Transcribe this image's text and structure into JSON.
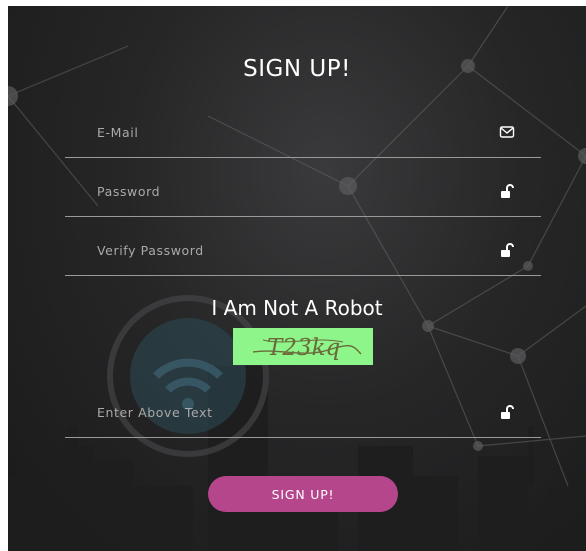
{
  "form": {
    "title": "SIGN UP!",
    "fields": [
      {
        "placeholder": "E-Mail",
        "value": "",
        "icon": "envelope-icon"
      },
      {
        "placeholder": "Password",
        "value": "",
        "icon": "unlock-icon"
      },
      {
        "placeholder": "Verify Password",
        "value": "",
        "icon": "unlock-icon"
      }
    ],
    "captcha": {
      "heading": "I Am Not A Robot",
      "text": "T23kq",
      "background": "#8ef58a",
      "input_placeholder": "Enter Above Text",
      "input_value": "",
      "icon": "unlock-icon"
    },
    "submit_label": "SIGN UP!"
  },
  "colors": {
    "background": "#262627",
    "button": "#b5468c",
    "text": "#ffffff",
    "placeholder": "#a9a9a9",
    "underline": "#9a9a9a"
  }
}
